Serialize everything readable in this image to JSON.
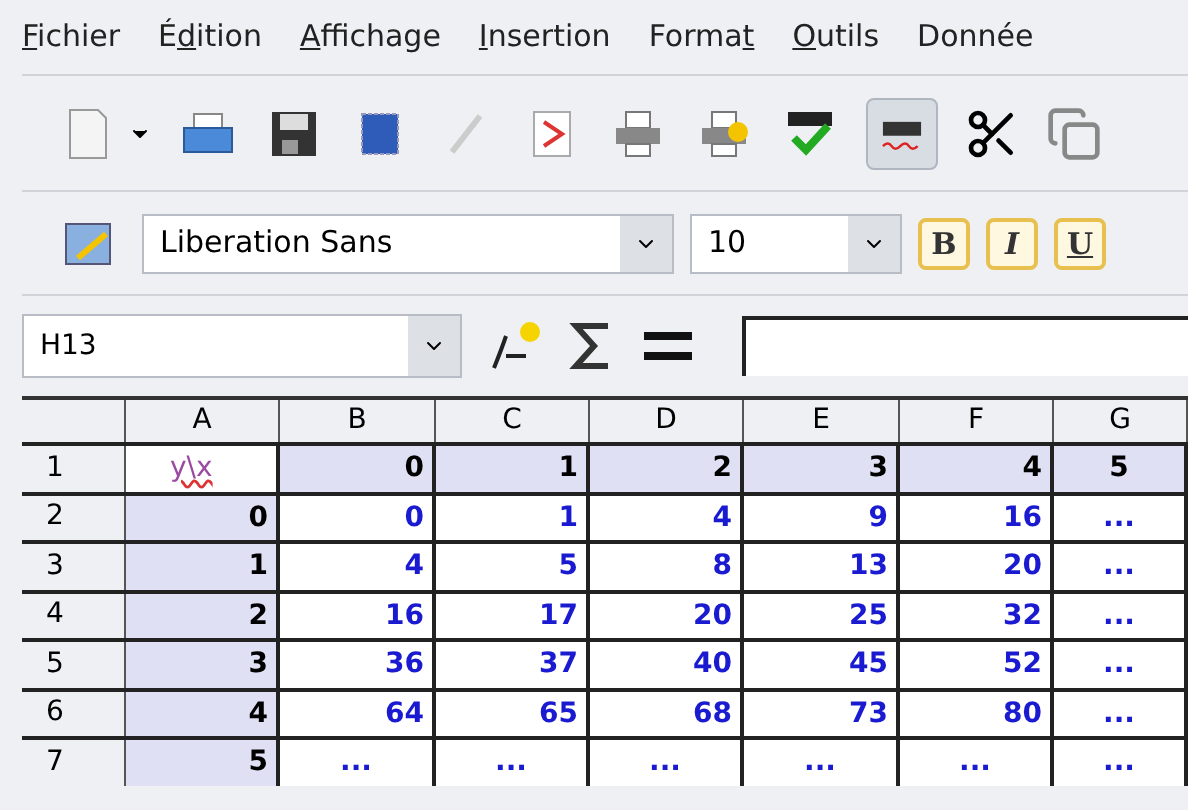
{
  "menu": [
    "Fichier",
    "Édition",
    "Affichage",
    "Insertion",
    "Format",
    "Outils",
    "Donnée"
  ],
  "toolbar": [
    {
      "kind": "new"
    },
    {
      "kind": "open"
    },
    {
      "kind": "save"
    },
    {
      "kind": "export"
    },
    {
      "kind": "edit",
      "disabled": true
    },
    {
      "kind": "pdf"
    },
    {
      "kind": "print"
    },
    {
      "kind": "print2"
    },
    {
      "kind": "spell"
    },
    {
      "kind": "autospell",
      "selected": true
    },
    {
      "kind": "cut"
    },
    {
      "kind": "copy"
    }
  ],
  "font": {
    "name": "Liberation Sans",
    "size": "10"
  },
  "format_buttons": [
    "B",
    "I",
    "U"
  ],
  "name_box": "H13",
  "columns": [
    "",
    "A",
    "B",
    "C",
    "D",
    "E",
    "F",
    "G"
  ],
  "rows": [
    {
      "header": "1",
      "cells": [
        {
          "text": "y\\x",
          "kind": "label"
        },
        {
          "text": "0",
          "kind": "head"
        },
        {
          "text": "1",
          "kind": "head"
        },
        {
          "text": "2",
          "kind": "head"
        },
        {
          "text": "3",
          "kind": "head"
        },
        {
          "text": "4",
          "kind": "head"
        },
        {
          "text": "5",
          "kind": "head_center"
        }
      ]
    },
    {
      "header": "2",
      "cells": [
        {
          "text": "0",
          "kind": "head"
        },
        {
          "text": "0",
          "kind": "value"
        },
        {
          "text": "1",
          "kind": "value"
        },
        {
          "text": "4",
          "kind": "value"
        },
        {
          "text": "9",
          "kind": "value"
        },
        {
          "text": "16",
          "kind": "value"
        },
        {
          "text": "...",
          "kind": "more"
        }
      ]
    },
    {
      "header": "3",
      "cells": [
        {
          "text": "1",
          "kind": "head"
        },
        {
          "text": "4",
          "kind": "value"
        },
        {
          "text": "5",
          "kind": "value"
        },
        {
          "text": "8",
          "kind": "value"
        },
        {
          "text": "13",
          "kind": "value"
        },
        {
          "text": "20",
          "kind": "value"
        },
        {
          "text": "...",
          "kind": "more"
        }
      ]
    },
    {
      "header": "4",
      "cells": [
        {
          "text": "2",
          "kind": "head"
        },
        {
          "text": "16",
          "kind": "value"
        },
        {
          "text": "17",
          "kind": "value"
        },
        {
          "text": "20",
          "kind": "value"
        },
        {
          "text": "25",
          "kind": "value"
        },
        {
          "text": "32",
          "kind": "value"
        },
        {
          "text": "...",
          "kind": "more"
        }
      ]
    },
    {
      "header": "5",
      "cells": [
        {
          "text": "3",
          "kind": "head"
        },
        {
          "text": "36",
          "kind": "value"
        },
        {
          "text": "37",
          "kind": "value"
        },
        {
          "text": "40",
          "kind": "value"
        },
        {
          "text": "45",
          "kind": "value"
        },
        {
          "text": "52",
          "kind": "value"
        },
        {
          "text": "...",
          "kind": "more"
        }
      ]
    },
    {
      "header": "6",
      "cells": [
        {
          "text": "4",
          "kind": "head"
        },
        {
          "text": "64",
          "kind": "value"
        },
        {
          "text": "65",
          "kind": "value"
        },
        {
          "text": "68",
          "kind": "value"
        },
        {
          "text": "73",
          "kind": "value"
        },
        {
          "text": "80",
          "kind": "value"
        },
        {
          "text": "...",
          "kind": "more"
        }
      ]
    },
    {
      "header": "7",
      "cells": [
        {
          "text": "5",
          "kind": "head"
        },
        {
          "text": "...",
          "kind": "more"
        },
        {
          "text": "...",
          "kind": "more"
        },
        {
          "text": "...",
          "kind": "more"
        },
        {
          "text": "...",
          "kind": "more"
        },
        {
          "text": "...",
          "kind": "more"
        },
        {
          "text": "...",
          "kind": "more"
        }
      ]
    }
  ]
}
